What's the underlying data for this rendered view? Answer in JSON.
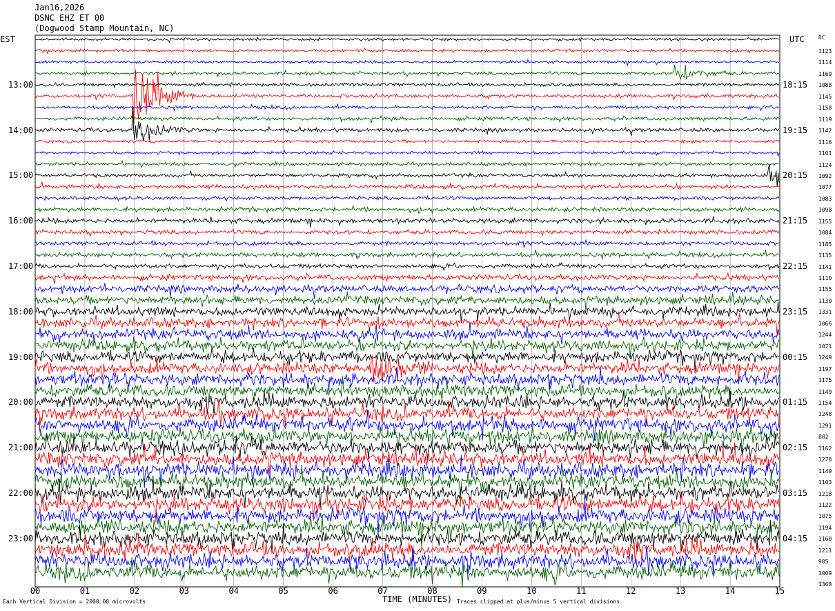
{
  "header": {
    "date": "Jan16,2026",
    "station": "DSNC EHZ ET 00",
    "location": "(Dogwood Stamp Mountain, NC)"
  },
  "labels": {
    "left_tz": "EST",
    "right_tz": "UTC",
    "dc_header": "DC"
  },
  "footer": {
    "scale_note": "Each Vertical Division = 2000.00 microvolts",
    "clip_note": "Traces clipped at plus/minus 5 vertical divisions"
  },
  "colors": {
    "cycle": [
      "#000000",
      "#ff0000",
      "#0000ff",
      "#006400"
    ]
  },
  "chart_data": {
    "type": "line",
    "title": "",
    "xlabel": "TIME (MINUTES)",
    "ylabel": "",
    "xlim": [
      0,
      15
    ],
    "x_ticks": [
      "00",
      "01",
      "02",
      "03",
      "04",
      "05",
      "06",
      "07",
      "08",
      "09",
      "10",
      "11",
      "12",
      "13",
      "14",
      "15"
    ],
    "left_hour_labels": [
      "13:00",
      "14:00",
      "15:00",
      "16:00",
      "17:00",
      "18:00",
      "19:00",
      "20:00",
      "21:00",
      "22:00",
      "23:00"
    ],
    "right_hour_labels": [
      "18:15",
      "19:15",
      "20:15",
      "21:15",
      "22:15",
      "23:15",
      "00:15",
      "01:15",
      "02:15",
      "03:15",
      "04:15"
    ],
    "dc_offsets": [
      1123,
      1114,
      1169,
      1088,
      1145,
      1158,
      1119,
      1142,
      1116,
      1101,
      1124,
      1092,
      1077,
      1083,
      1098,
      1155,
      1084,
      1185,
      1135,
      1141,
      1110,
      1155,
      1130,
      1331,
      1066,
      1244,
      1071,
      1249,
      1197,
      1175,
      1149,
      1154,
      1248,
      1291,
      882,
      1162,
      1270,
      1149,
      1103,
      1218,
      1122,
      1075,
      1194,
      1160,
      1211,
      905,
      1009,
      1368
    ],
    "trace_count": 48,
    "activity_levels": [
      1,
      1,
      1,
      1.2,
      1.2,
      1.3,
      1.2,
      1.3,
      1.4,
      1,
      1,
      1.2,
      1.3,
      1.5,
      1.3,
      1.6,
      1.7,
      1.5,
      1.5,
      1.6,
      1.6,
      2,
      2.5,
      3,
      3.2,
      3.4,
      3.6,
      3.8,
      4,
      4,
      4.2,
      4.2,
      4.4,
      4.4,
      4.6,
      4.6,
      4.8,
      4.8,
      5,
      5,
      5,
      5,
      5,
      5,
      5,
      5,
      5,
      5
    ],
    "events": [
      {
        "trace": 5,
        "minute": 2.0,
        "amplitude": 8
      },
      {
        "trace": 8,
        "minute": 2.0,
        "amplitude": 3
      },
      {
        "trace": 3,
        "minute": 12.9,
        "amplitude": 2
      },
      {
        "trace": 12,
        "minute": 14.8,
        "amplitude": 2
      },
      {
        "trace": 29,
        "minute": 6.8,
        "amplitude": 3
      }
    ]
  }
}
